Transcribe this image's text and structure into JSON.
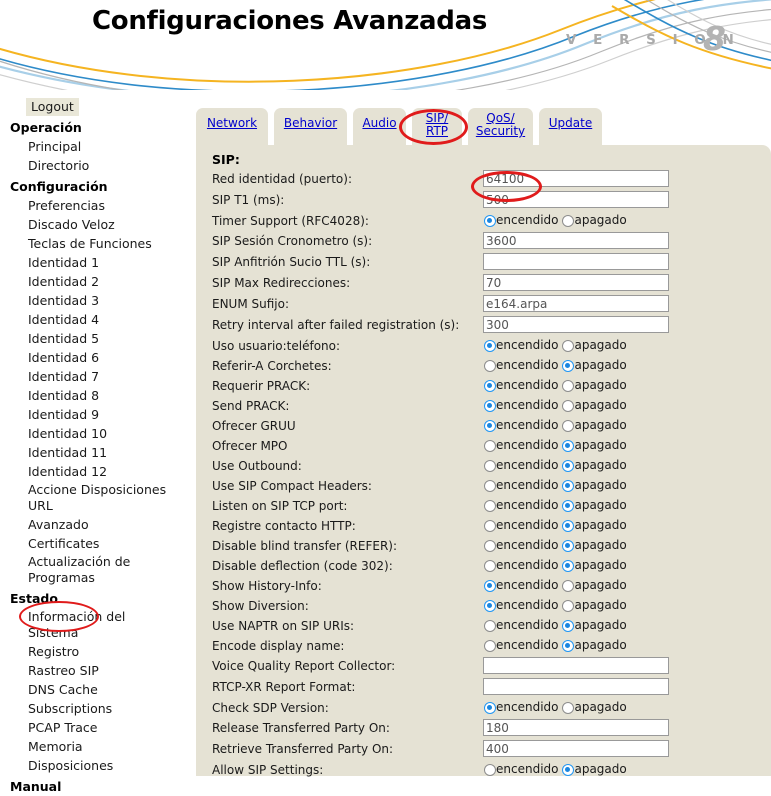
{
  "header": {
    "title": "Configuraciones Avanzadas",
    "version_word": "V E R S I O N",
    "version_number": "8"
  },
  "sidebar": {
    "logout_label": "Logout",
    "groups": [
      {
        "title": "Operación",
        "items": [
          "Principal",
          "Directorio"
        ]
      },
      {
        "title": "Configuración",
        "items": [
          "Preferencias",
          "Discado Veloz",
          "Teclas de Funciones",
          "Identidad 1",
          "Identidad 2",
          "Identidad 3",
          "Identidad 4",
          "Identidad 5",
          "Identidad 6",
          "Identidad 7",
          "Identidad 8",
          "Identidad 9",
          "Identidad 10",
          "Identidad 11",
          "Identidad 12",
          "Accione Disposiciones URL",
          "Avanzado",
          "Certificates",
          "Actualización de Programas"
        ]
      },
      {
        "title": "Estado",
        "items": [
          "Información del Sistema",
          "Registro",
          "Rastreo SIP",
          "DNS Cache",
          "Subscriptions",
          "PCAP Trace",
          "Memoria",
          "Disposiciones"
        ]
      },
      {
        "title": "Manual",
        "items": []
      }
    ],
    "highlighted_item": "Avanzado"
  },
  "tabs": [
    {
      "label": "Network",
      "lines": [
        "Network"
      ],
      "selected": false
    },
    {
      "label": "Behavior",
      "lines": [
        "Behavior"
      ],
      "selected": false
    },
    {
      "label": "Audio",
      "lines": [
        "Audio"
      ],
      "selected": false
    },
    {
      "label": "SIP/RTP",
      "lines": [
        "SIP/",
        "RTP"
      ],
      "selected": true
    },
    {
      "label": "QoS/Security",
      "lines": [
        "QoS/",
        "Security"
      ],
      "selected": false
    },
    {
      "label": "Update",
      "lines": [
        "Update"
      ],
      "selected": false
    }
  ],
  "panel": {
    "section_heading": "SIP:",
    "radio_on_label": "encendido",
    "radio_off_label": "apagado",
    "help_icon": "help-question-icon",
    "rows": [
      {
        "type": "text",
        "label": "Red identidad (puerto):",
        "value": "64100"
      },
      {
        "type": "text",
        "label": "SIP T1 (ms):",
        "value": "500"
      },
      {
        "type": "radio",
        "label": "Timer Support (RFC4028):",
        "value": "encendido"
      },
      {
        "type": "text",
        "label": "SIP Sesión Cronometro (s):",
        "value": "3600"
      },
      {
        "type": "text",
        "label": "SIP Anfitrión Sucio TTL (s):",
        "value": ""
      },
      {
        "type": "text",
        "label": "SIP Max Redirecciones:",
        "value": "70"
      },
      {
        "type": "text",
        "label": "ENUM Sufijo:",
        "value": "e164.arpa"
      },
      {
        "type": "text",
        "label": "Retry interval after failed registration (s):",
        "value": "300"
      },
      {
        "type": "radio",
        "label": "Uso usuario:teléfono:",
        "value": "encendido"
      },
      {
        "type": "radio",
        "label": "Referir-A Corchetes:",
        "value": "apagado"
      },
      {
        "type": "radio",
        "label": "Requerir PRACK:",
        "value": "encendido"
      },
      {
        "type": "radio",
        "label": "Send PRACK:",
        "value": "encendido"
      },
      {
        "type": "radio",
        "label": "Ofrecer GRUU",
        "value": "encendido"
      },
      {
        "type": "radio",
        "label": "Ofrecer MPO",
        "value": "apagado"
      },
      {
        "type": "radio",
        "label": "Use Outbound:",
        "value": "apagado"
      },
      {
        "type": "radio",
        "label": "Use SIP Compact Headers:",
        "value": "apagado"
      },
      {
        "type": "radio",
        "label": "Listen on SIP TCP port:",
        "value": "apagado"
      },
      {
        "type": "radio",
        "label": "Registre contacto HTTP:",
        "value": "apagado"
      },
      {
        "type": "radio",
        "label": "Disable blind transfer (REFER):",
        "value": "apagado"
      },
      {
        "type": "radio",
        "label": "Disable deflection (code 302):",
        "value": "apagado"
      },
      {
        "type": "radio",
        "label": "Show History-Info:",
        "value": "encendido"
      },
      {
        "type": "radio",
        "label": "Show Diversion:",
        "value": "encendido"
      },
      {
        "type": "radio",
        "label": "Use NAPTR on SIP URIs:",
        "value": "apagado"
      },
      {
        "type": "radio",
        "label": "Encode display name:",
        "value": "apagado"
      },
      {
        "type": "text",
        "label": "Voice Quality Report Collector:",
        "value": ""
      },
      {
        "type": "text",
        "label": "RTCP-XR Report Format:",
        "value": ""
      },
      {
        "type": "radio",
        "label": "Check SDP Version:",
        "value": "encendido"
      },
      {
        "type": "text",
        "label": "Release Transferred Party On:",
        "value": "180"
      },
      {
        "type": "text",
        "label": "Retrieve Transferred Party On:",
        "value": "400"
      },
      {
        "type": "radio",
        "label": "Allow SIP Settings:",
        "value": "apagado"
      }
    ]
  },
  "annotations": [
    {
      "name": "ellipse-sidebar-avanzado",
      "target": "Avanzado"
    },
    {
      "name": "ellipse-tab-sip-rtp",
      "target": "SIP/RTP"
    },
    {
      "name": "ellipse-port-value",
      "target": "64100"
    }
  ],
  "colors": {
    "panel_bg": "#e5e2d4",
    "link": "#0000cc",
    "annotation_red": "#e01b1b",
    "radio_on": "#1a86e0",
    "swoosh_gold": "#f5b421",
    "swoosh_blue": "#2e8bc9",
    "swoosh_lightblue": "#a8cfe8",
    "swoosh_gray": "#b5b5b5"
  }
}
